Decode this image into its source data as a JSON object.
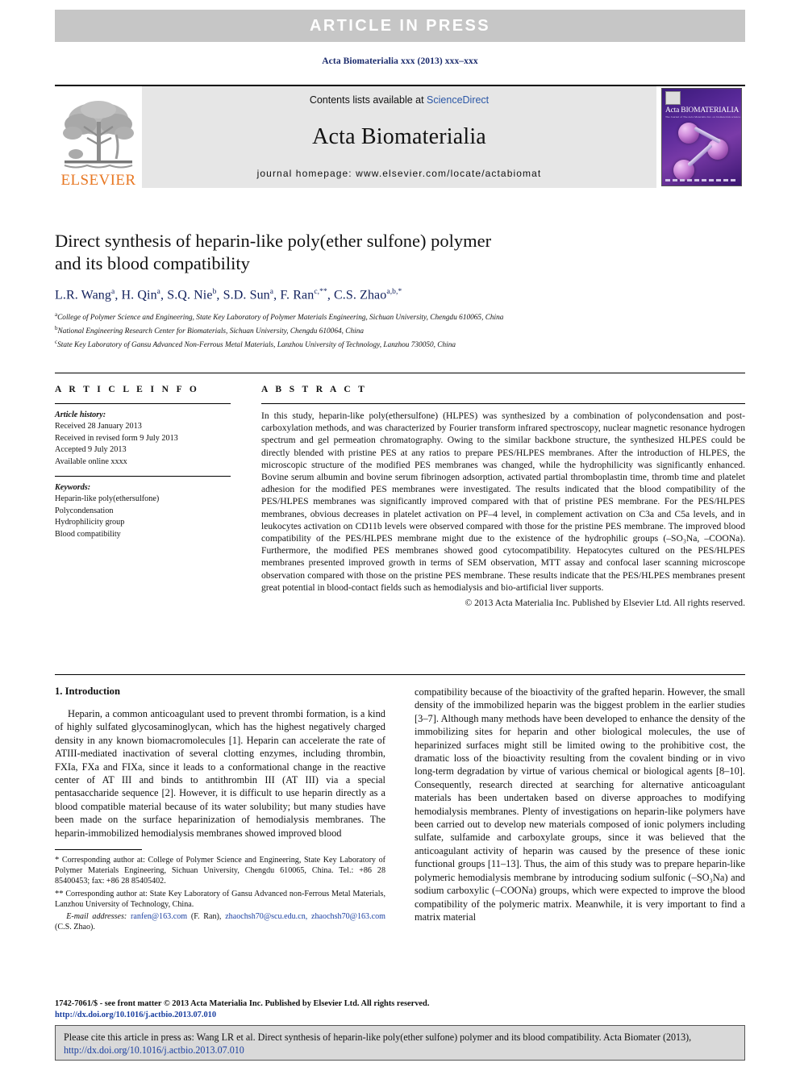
{
  "banner": {
    "text": "ARTICLE  IN  PRESS"
  },
  "journal_ref": "Acta Biomaterialia xxx (2013) xxx–xxx",
  "masthead": {
    "publisher_name": "ELSEVIER",
    "contents_prefix": "Contents lists available at ",
    "contents_link": "ScienceDirect",
    "journal_title": "Acta Biomaterialia",
    "homepage": "journal homepage: www.elsevier.com/locate/actabiomat",
    "cover_title": "Acta BIOMATERIALIA",
    "cover_subtitle": "The Journal of The Acta Materialia Inc. on biomaterials science and engineering"
  },
  "article": {
    "title_line1": "Direct synthesis of heparin-like poly(ether sulfone) polymer",
    "title_line2": "and its blood compatibility",
    "authors": [
      {
        "name": "L.R. Wang",
        "sup": "a",
        "sep": ", "
      },
      {
        "name": "H. Qin",
        "sup": "a",
        "sep": ", "
      },
      {
        "name": "S.Q. Nie",
        "sup": "b",
        "sep": ", "
      },
      {
        "name": "S.D. Sun",
        "sup": "a",
        "sep": ", "
      },
      {
        "name": "F. Ran",
        "sup": "c,**",
        "sep": ", "
      },
      {
        "name": "C.S. Zhao",
        "sup": "a,b,*",
        "sep": ""
      }
    ],
    "affiliations": [
      {
        "marker": "a",
        "text": "College of Polymer Science and Engineering, State Key Laboratory of Polymer Materials Engineering, Sichuan University, Chengdu 610065, China"
      },
      {
        "marker": "b",
        "text": "National Engineering Research Center for Biomaterials, Sichuan University, Chengdu 610064, China"
      },
      {
        "marker": "c",
        "text": "State Key Laboratory of Gansu Advanced Non-Ferrous Metal Materials, Lanzhou University of Technology, Lanzhou 730050, China"
      }
    ]
  },
  "article_info": {
    "heading": "A R T I C L E   I N F O",
    "history_label": "Article history:",
    "history": [
      "Received 28 January 2013",
      "Received in revised form 9 July 2013",
      "Accepted 9 July 2013",
      "Available online xxxx"
    ],
    "keywords_label": "Keywords:",
    "keywords": [
      "Heparin-like poly(ethersulfone)",
      "Polycondensation",
      "Hydrophilicity group",
      "Blood compatibility"
    ]
  },
  "abstract": {
    "heading": "A B S T R A C T",
    "body": "In this study, heparin-like poly(ethersulfone) (HLPES) was synthesized by a combination of polycondensation and post-carboxylation methods, and was characterized by Fourier transform infrared spectroscopy, nuclear magnetic resonance hydrogen spectrum and gel permeation chromatography. Owing to the similar backbone structure, the synthesized HLPES could be directly blended with pristine PES at any ratios to prepare PES/HLPES membranes. After the introduction of HLPES, the microscopic structure of the modified PES membranes was changed, while the hydrophilicity was significantly enhanced. Bovine serum albumin and bovine serum fibrinogen adsorption, activated partial thromboplastin time, thromb time and platelet adhesion for the modified PES membranes were investigated. The results indicated that the blood compatibility of the PES/HLPES membranes was significantly improved compared with that of pristine PES membrane. For the PES/HLPES membranes, obvious decreases in platelet activation on PF–4 level, in complement activation on C3a and C5a levels, and in leukocytes activation on CD11b levels were observed compared with those for the pristine PES membrane. The improved blood compatibility of the PES/HLPES membrane might due to the existence of the hydrophilic groups (–SO₃Na, –COONa). Furthermore, the modified PES membranes showed good cytocompatibility. Hepatocytes cultured on the PES/HLPES membranes presented improved growth in terms of SEM observation, MTT assay and confocal laser scanning microscope observation compared with those on the pristine PES membrane. These results indicate that the PES/HLPES membranes present great potential in blood-contact fields such as hemodialysis and bio-artificial liver supports.",
    "copyright": "© 2013 Acta Materialia Inc. Published by Elsevier Ltd. All rights reserved."
  },
  "introduction": {
    "heading": "1. Introduction",
    "left_para": "Heparin, a common anticoagulant used to prevent thrombi formation, is a kind of highly sulfated glycosaminoglycan, which has the highest negatively charged density in any known biomacromolecules [1]. Heparin can accelerate the rate of ATIII-mediated inactivation of several clotting enzymes, including thrombin, FXIa, FXa and FIXa, since it leads to a conformational change in the reactive center of AT III and binds to antithrombin III (AT III) via a special pentasaccharide sequence [2]. However, it is difficult to use heparin directly as a blood compatible material because of its water solubility; but many studies have been made on the surface heparinization of hemodialysis membranes. The heparin-immobilized hemodialysis membranes showed improved blood",
    "right_para": "compatibility because of the bioactivity of the grafted heparin. However, the small density of the immobilized heparin was the biggest problem in the earlier studies [3–7]. Although many methods have been developed to enhance the density of the immobilizing sites for heparin and other biological molecules, the use of heparinized surfaces might still be limited owing to the prohibitive cost, the dramatic loss of the bioactivity resulting from the covalent binding or in vivo long-term degradation by virtue of various chemical or biological agents [8–10]. Consequently, research directed at searching for alternative anticoagulant materials has been undertaken based on diverse approaches to modifying hemodialysis membranes. Plenty of investigations on heparin-like polymers have been carried out to develop new materials composed of ionic polymers including sulfate, sulfamide and carboxylate groups, since it was believed that the anticoagulant activity of heparin was caused by the presence of these ionic functional groups [11–13]. Thus, the aim of this study was to prepare heparin-like polymeric hemodialysis membrane by introducing sodium sulfonic (–SO₃Na) and sodium carboxylic (–COONa) groups, which were expected to improve the blood compatibility of the polymeric matrix. Meanwhile, it is very important to find a matrix material"
  },
  "footnotes": {
    "corresponding_1": "Corresponding author at: College of Polymer Science and Engineering, State Key Laboratory of Polymer Materials Engineering, Sichuan University, Chengdu 610065, China. Tel.: +86 28 85400453; fax: +86 28 85405402.",
    "corresponding_1_marker": "*",
    "corresponding_2": "Corresponding author at: State Key Laboratory of Gansu Advanced non-Ferrous Metal Materials, Lanzhou University of Technology, China.",
    "corresponding_2_marker": "**",
    "email_label": "E-mail addresses:",
    "email_1": "ranfen@163.com",
    "email_1_owner": "(F. Ran),",
    "email_2": "zhaochsh70@scu.edu.cn,",
    "email_3": "zhaochsh70@163.com",
    "email_3_owner": "(C.S. Zhao)."
  },
  "footer": {
    "issn_line": "1742-7061/$ - see front matter © 2013 Acta Materialia Inc. Published by Elsevier Ltd. All rights reserved.",
    "doi_line": "http://dx.doi.org/10.1016/j.actbio.2013.07.010",
    "citation_prefix": "Please cite this article in press as: Wang LR et al. Direct synthesis of heparin-like poly(ether sulfone) polymer and its blood compatibility. Acta Biomater (2013), ",
    "citation_link": "http://dx.doi.org/10.1016/j.actbio.2013.07.010"
  }
}
